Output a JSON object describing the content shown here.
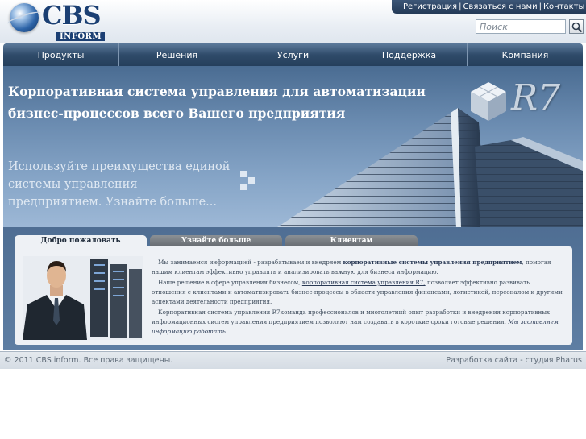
{
  "header": {
    "logo_text": "CBS",
    "logo_sub": "INFORM",
    "top_links": [
      "Регистрация",
      "Связаться с нами",
      "Контакты"
    ],
    "search_placeholder": "Поиск"
  },
  "nav": {
    "items": [
      "Продукты",
      "Решения",
      "Услуги",
      "Поддержка",
      "Компания"
    ]
  },
  "banner": {
    "title": "Корпоративная система управления для автоматизации бизнес-процессов всего Вашего предприятия",
    "text": "Используйте преимущества единой системы управления предприятием.",
    "more": "Узнайте больше...",
    "r7_label": "R7"
  },
  "tabs": [
    "Добро пожаловать",
    "Узнайте больше",
    "Клиентам"
  ],
  "panel": {
    "p1_a": "Мы занимаемся информацией - разрабатываем и внедряем",
    "p1_link": "корпоративные системы управления предприятием",
    "p1_b": ", помогая нашим клиентам эффективно управлять и анализировать важную для бизнеса информацию.",
    "p2_a": "Наше решение в сфере управления бизнесом,",
    "p2_link": "корпоративная система управления R7,",
    "p2_b": "позволяет эффективно развивать отношения с клиентами и автоматизировать бизнес-процессы в области управления финансами, логистикой, персоналом и другими аспектами деятельности предприятия.",
    "p3_a": "Корпоративная система управления R7команда профессионалов и многолетний опыт разработки и внедрения корпоративных информационных систем управления предприятием позволяют нам создавать в короткие сроки готовые решения.",
    "p3_italic": "Мы заставляем информацию работать."
  },
  "footer": {
    "copyright": "© 2011 CBS inform. Все права защищены.",
    "developer": "Разработка сайта - студия Pharus"
  }
}
